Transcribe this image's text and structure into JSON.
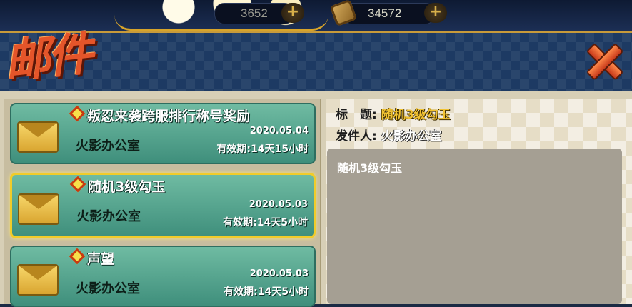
{
  "currency": {
    "currency1_value": "3652",
    "currency2_value": "34572",
    "plus_label": "+"
  },
  "header": {
    "title": "邮件",
    "close_label": "✕"
  },
  "mails": [
    {
      "title": "叛忍来袭跨服排行称号奖励",
      "sender": "火影办公室",
      "date": "2020.05.04",
      "expiry": "有效期:14天15小时"
    },
    {
      "title": "随机3级勾玉",
      "sender": "火影办公室",
      "date": "2020.05.03",
      "expiry": "有效期:14天5小时",
      "selected": true
    },
    {
      "title": "声望",
      "sender": "火影办公室",
      "date": "2020.05.03",
      "expiry": "有效期:14天5小时"
    }
  ],
  "detail": {
    "title_label": "标　题:",
    "title_value": "随机3级勾玉",
    "sender_label": "发件人:",
    "sender_value": "火影办公室",
    "content": "随机3级勾玉"
  },
  "colors": {
    "accent_gold": "#f1cc2a",
    "mail_teal": "#4f9f8a",
    "title_red": "#e4552a"
  }
}
